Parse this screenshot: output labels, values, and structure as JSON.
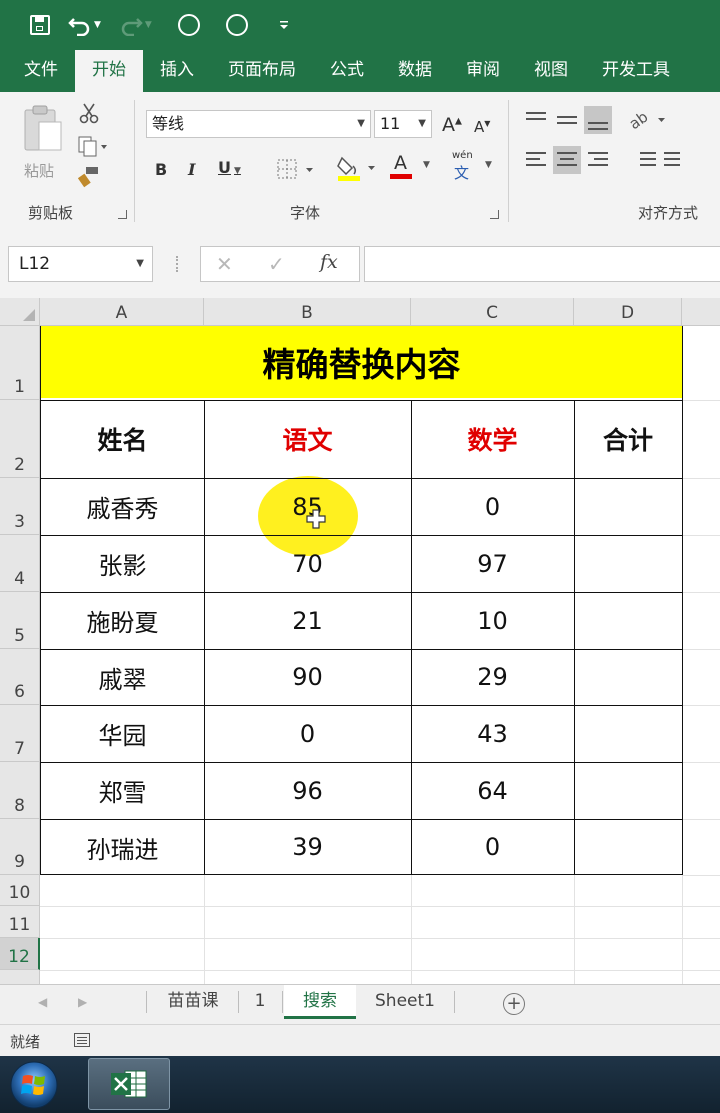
{
  "quick_access": {
    "icons": [
      "save-icon",
      "undo-icon",
      "redo-icon",
      "circle-icon",
      "circle-icon",
      "customize-icon"
    ]
  },
  "ribbon_tabs": [
    {
      "label": "文件"
    },
    {
      "label": "开始",
      "active": true
    },
    {
      "label": "插入"
    },
    {
      "label": "页面布局"
    },
    {
      "label": "公式"
    },
    {
      "label": "数据"
    },
    {
      "label": "审阅"
    },
    {
      "label": "视图"
    },
    {
      "label": "开发工具"
    }
  ],
  "ribbon": {
    "clipboard": {
      "paste_label": "粘贴",
      "group_label": "剪贴板"
    },
    "font": {
      "font_name": "等线",
      "font_size": "11",
      "grow_label": "A",
      "shrink_label": "A",
      "bold": "B",
      "italic": "I",
      "underline": "U",
      "font_color_label": "A",
      "phonetic_label": "wén",
      "phonetic_char": "文",
      "group_label": "字体"
    },
    "alignment": {
      "group_label": "对齐方式"
    }
  },
  "formula_bar": {
    "name_box": "L12",
    "fx": "fx",
    "cancel": "✕",
    "enter": "✓",
    "value": ""
  },
  "columns": [
    "A",
    "B",
    "C",
    "D"
  ],
  "rows": [
    "1",
    "2",
    "3",
    "4",
    "5",
    "6",
    "7",
    "8",
    "9",
    "10",
    "11",
    "12"
  ],
  "selected_row": "12",
  "table": {
    "title": "精确替换内容",
    "headers": [
      "姓名",
      "语文",
      "数学",
      "合计"
    ],
    "rows": [
      [
        "戚香秀",
        "85",
        "0",
        ""
      ],
      [
        "张影",
        "70",
        "97",
        ""
      ],
      [
        "施盼夏",
        "21",
        "10",
        ""
      ],
      [
        "戚翠",
        "90",
        "29",
        ""
      ],
      [
        "华园",
        "0",
        "43",
        ""
      ],
      [
        "郑雪",
        "96",
        "64",
        ""
      ],
      [
        "孙瑞进",
        "39",
        "0",
        ""
      ]
    ]
  },
  "colors": {
    "excel_green": "#217346",
    "title_fill": "#ffff00",
    "header_red": "#e00000"
  },
  "sheet_tabs": [
    {
      "label": "苗苗课"
    },
    {
      "label": "1"
    },
    {
      "label": "搜索",
      "active": true
    },
    {
      "label": "Sheet1"
    }
  ],
  "status_bar": {
    "status": "就绪"
  },
  "taskbar": {
    "apps": [
      "windows-start-icon",
      "excel-icon"
    ]
  }
}
